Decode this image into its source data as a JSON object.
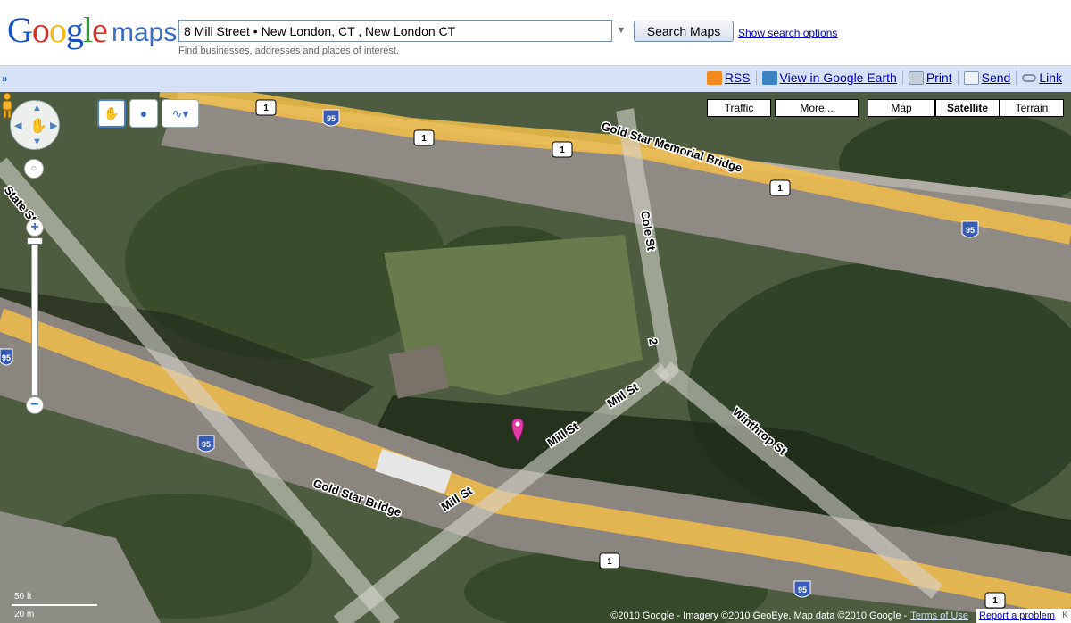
{
  "header": {
    "logo_text": "Google",
    "logo_suffix": "maps",
    "search_value": "8 Mill Street • New London, CT , New London CT",
    "search_button": "Search Maps",
    "search_options_link": "Show search options",
    "hint": "Find businesses, addresses and places of interest."
  },
  "toolbar": {
    "collapse": "»",
    "links": [
      {
        "label": "RSS",
        "icon": "rss-icon"
      },
      {
        "label": "View in Google Earth",
        "icon": "google-earth-icon"
      },
      {
        "label": "Print",
        "icon": "print-icon"
      },
      {
        "label": "Send",
        "icon": "mail-icon"
      },
      {
        "label": "Link",
        "icon": "link-icon"
      }
    ]
  },
  "map": {
    "type_buttons": {
      "traffic": "Traffic",
      "more": "More...",
      "map": "Map",
      "satellite": "Satellite",
      "terrain": "Terrain",
      "active": "Satellite"
    },
    "zoom": {
      "plus": "+",
      "minus": "−"
    },
    "scale": {
      "top": "50 ft",
      "bottom": "20 m"
    },
    "roads": {
      "gold_star_memorial_bridge": "Gold Star Memorial Bridge",
      "gold_star_bridge": "Gold Star Bridge",
      "mill_st": "Mill St",
      "cole_st": "Cole St",
      "winthrop_st": "Winthrop St",
      "state_st": "State St",
      "route_number": "2"
    },
    "shields": {
      "us1": "1",
      "i95": "95"
    },
    "attribution": "©2010 Google - Imagery ©2010 GeoEye, Map data ©2010 Google -",
    "terms": "Terms of Use",
    "report": "Report a problem",
    "corner": "K"
  }
}
